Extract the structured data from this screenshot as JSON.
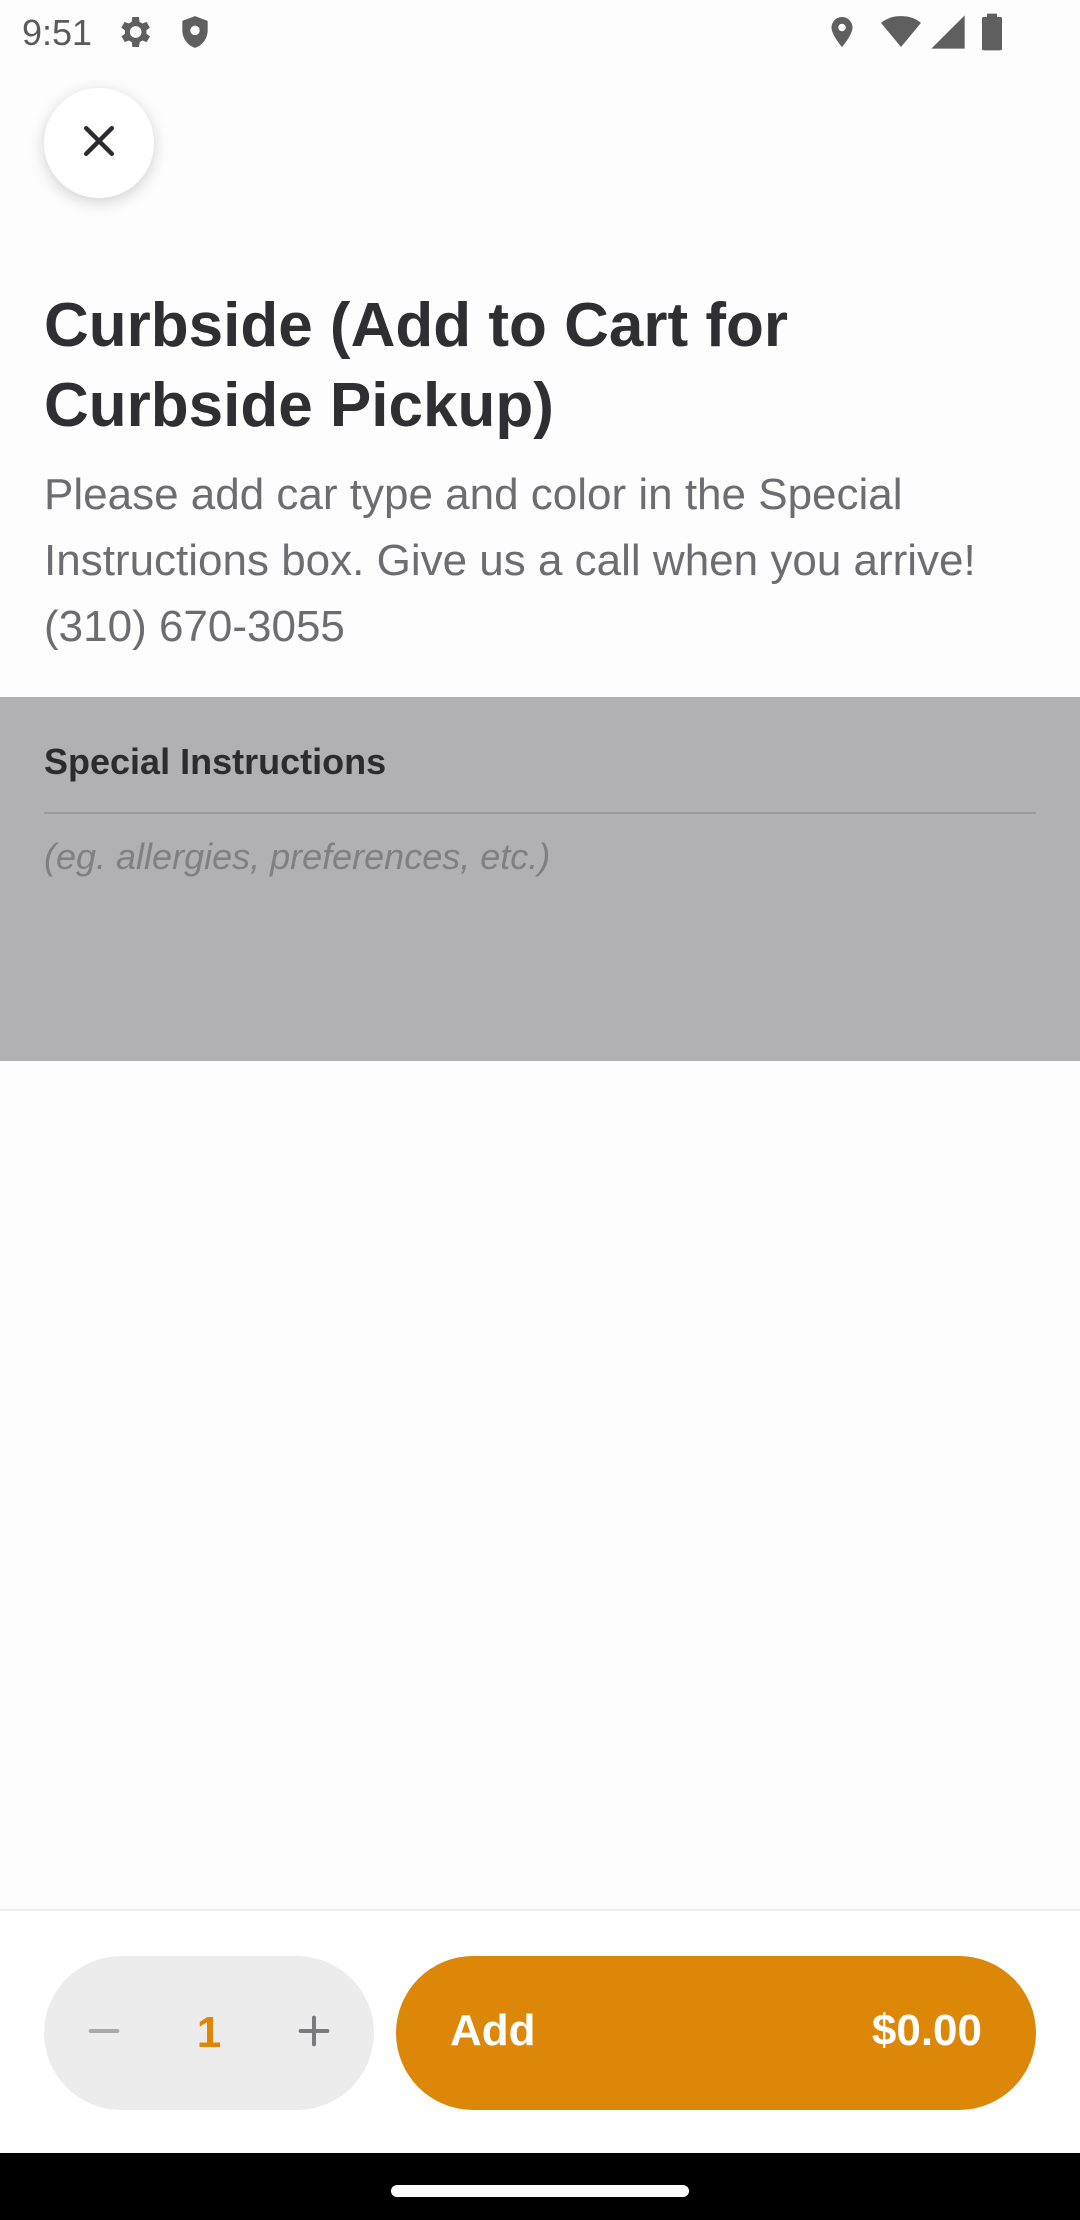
{
  "status_bar": {
    "time": "9:51",
    "icons": [
      "gear-icon",
      "shield-icon",
      "location-icon",
      "wifi-icon",
      "signal-icon",
      "battery-icon"
    ]
  },
  "item": {
    "title": "Curbside (Add to Cart for Curbside Pickup)",
    "description": "Please add car type and color in the Special Instructions box. Give us a call when you arrive! (310) 670-3055"
  },
  "special_instructions": {
    "label": "Special Instructions",
    "placeholder": "(eg. allergies, preferences, etc.)",
    "value": ""
  },
  "quantity": {
    "value": "1"
  },
  "add_button": {
    "label": "Add",
    "price": "$0.00"
  },
  "colors": {
    "accent": "#dc8708",
    "overlay_panel": "#b1b0b3",
    "title_text": "#2f2f33",
    "body_text": "#6d6c70"
  }
}
